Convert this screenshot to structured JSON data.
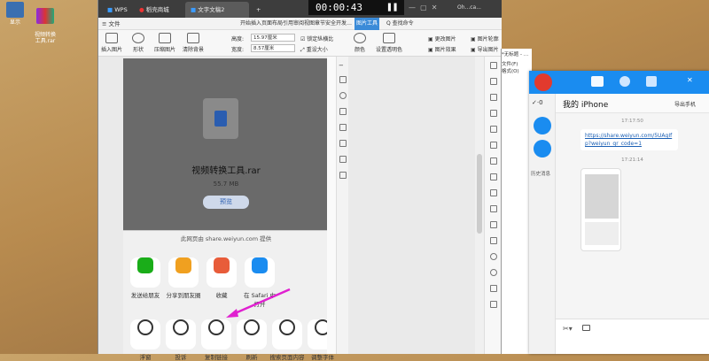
{
  "desktop": {
    "icons": [
      {
        "label": "显示"
      },
      {
        "label": "视频转换\n工具.rar"
      }
    ]
  },
  "recorder": {
    "time": "00:00:43"
  },
  "wps": {
    "tabs": [
      {
        "label": "WPS"
      },
      {
        "label": "稻壳商城"
      },
      {
        "label": "文字文稿2"
      },
      {
        "label": "+"
      }
    ],
    "title": "开始插入页面布局引用审阅视图章节安全开发工具特色应用",
    "picture_tools_tab": "图片工具",
    "search_label": "Q 查找命令",
    "user_label": "Oh...ca...",
    "menu": [
      {
        "label": "≡ 文件"
      },
      {
        "label": "插入图片"
      },
      {
        "label": "形状"
      },
      {
        "label": "压缩图片"
      },
      {
        "label": "图片"
      },
      {
        "label": "重设大小"
      }
    ],
    "toolbar": {
      "insert_picture": "插入图片",
      "shape": "形状",
      "compress": "压缩图片",
      "clear": "清除背景",
      "height_label": "高度:",
      "height_value": "15.97厘米",
      "width_label": "宽度:",
      "width_value": "8.57厘米",
      "lock_ratio": "锁定纵横比",
      "reset_size": "重设大小",
      "color": "颜色",
      "effects": "设置透明色",
      "picture_effects": "图片效果",
      "change_picture": "更改图片",
      "reset_picture": "重设图片",
      "outline": "图片轮廓",
      "export": "导出图片"
    },
    "document": {
      "file_name": "视频转换工具.rar",
      "file_size": "55.7 MB",
      "preview_button": "预览",
      "provider_text": "此网页由 share.weiyun.com 提供",
      "share_row": [
        {
          "label": "发送给朋友",
          "color": "#1aad19"
        },
        {
          "label": "分享到朋友圈",
          "color": "#f0a020"
        },
        {
          "label": "收藏",
          "color": "#e85c3a"
        },
        {
          "label": "在 Safari 中\n打开",
          "color": "#1a8cf0"
        }
      ],
      "action_row": [
        {
          "label": "浮窗"
        },
        {
          "label": "投诉"
        },
        {
          "label": "复制链接"
        },
        {
          "label": "刷新"
        },
        {
          "label": "搜索页面内容"
        },
        {
          "label": "调整字体"
        }
      ]
    }
  },
  "notepad": {
    "title": "*无标题 - 记事本",
    "menu": [
      "文件(F)",
      "编辑(E)",
      "格式(O)",
      "查看(V)",
      "帮助(H)"
    ]
  },
  "qq": {
    "unread_count": "0",
    "chat_title": "我的 iPhone",
    "export_label": "导出手机",
    "history_label": "历史消息",
    "messages": [
      {
        "time": "17:17:50",
        "text": "https://share.weiyun.com/5UAgIfp?weiyun_qr_code=1"
      },
      {
        "time": "17:21:14",
        "text": ""
      }
    ],
    "accent": "#1a8cf0"
  }
}
